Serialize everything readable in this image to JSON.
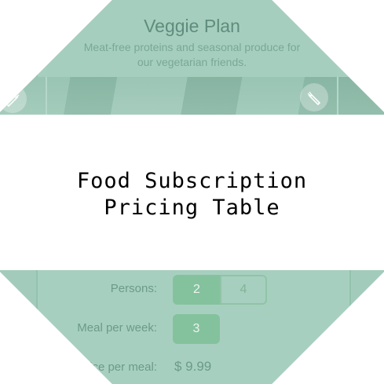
{
  "plan": {
    "title": "Veggie Plan",
    "description": "Meat-free proteins and seasonal produce for our vegetarian friends."
  },
  "banner": {
    "line1": "Food Subscription",
    "line2": "Pricing Table"
  },
  "options": {
    "persons_label": "Persons:",
    "persons_values": [
      "2",
      "4"
    ],
    "persons_selected": "2",
    "meals_label": "Meal per week:",
    "meals_value": "3",
    "price_label": "Price per meal:",
    "price_value": "$ 9.99"
  },
  "icons": {
    "left": "carrot-icon",
    "right": "carrot-icon"
  },
  "colors": {
    "accent": "#84c29d",
    "overlay": "#a2cbbb",
    "heading": "#5f8c7d"
  }
}
